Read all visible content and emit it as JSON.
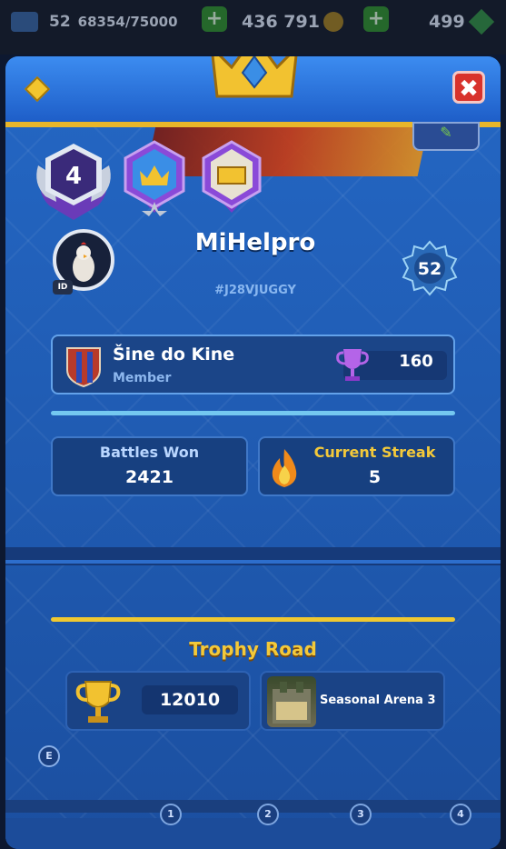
{
  "topbar": {
    "level": "52",
    "xp": "68354/75000",
    "gold": "436 791",
    "gems": "499"
  },
  "header": {
    "close_label": "✖"
  },
  "badges": {
    "first_badge_value": "4"
  },
  "player": {
    "name": "MiHelpro",
    "tag": "#J28VJUGGY",
    "id_label": "ID",
    "exp_level": "52"
  },
  "clan": {
    "name": "Šine do Kine",
    "role": "Member",
    "trophies": "160"
  },
  "stats": {
    "battles_won_label": "Battles Won",
    "battles_won_value": "2421",
    "streak_label": "Current Streak",
    "streak_value": "5"
  },
  "trophy_road": {
    "title": "Trophy Road",
    "trophies": "12010",
    "arena": "Seasonal Arena 3"
  },
  "bottom": {
    "e_label": "E",
    "pages": [
      "1",
      "2",
      "3",
      "4"
    ]
  },
  "colors": {
    "panel_blue": "#1d58b0",
    "gold": "#f0c830",
    "close_red": "#d8322c"
  }
}
